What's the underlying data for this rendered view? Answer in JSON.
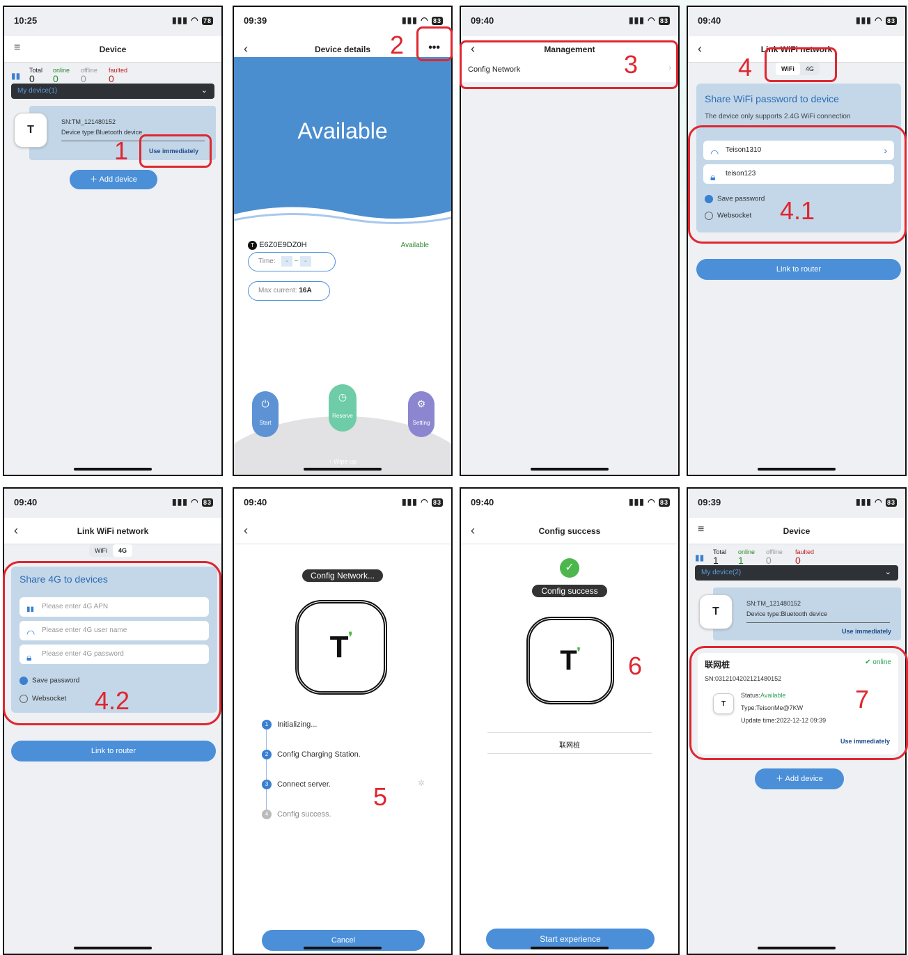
{
  "p1": {
    "time": "10:25",
    "batt": "78",
    "title": "Device",
    "total_l": "Total",
    "total_v": "0",
    "online_l": "online",
    "online_v": "0",
    "offline_l": "offline",
    "offline_v": "0",
    "faulted_l": "faulted",
    "faulted_v": "0",
    "my_device": "My device(1)",
    "sn": "SN:TM_121480152",
    "type": "Device type:Bluetooth device",
    "use": "Use immediately",
    "add": "Add device",
    "step": "1"
  },
  "p2": {
    "time": "09:39",
    "batt": "83",
    "title": "Device details",
    "status_big": "Available",
    "dev_id": "E6Z0E9DZ0H",
    "dev_status": "Available",
    "time_l": "Time:",
    "dash1": "-",
    "tilde": "~",
    "dash2": "-",
    "maxc_l": "Max current:",
    "maxc_v": "16A",
    "start": "Start",
    "reserve": "Reserve",
    "setting": "Setting",
    "wipe": "↑ Wipe up",
    "step": "2"
  },
  "p3": {
    "time": "09:40",
    "batt": "83",
    "title": "Management",
    "item": "Config Network",
    "step": "3"
  },
  "p4": {
    "time": "09:40",
    "batt": "83",
    "title": "Link WiFi network",
    "tab_wifi": "WiFi",
    "tab_4g": "4G",
    "heading": "Share WiFi password to device",
    "note": "The device only supports 2.4G WiFi connection",
    "ssid": "Teison1310",
    "pwd": "teison123",
    "save": "Save password",
    "ws": "Websocket",
    "link": "Link to router",
    "step": "4",
    "step2": "4.1"
  },
  "p5": {
    "time": "09:40",
    "batt": "83",
    "title": "Link WiFi network",
    "tab_wifi": "WiFi",
    "tab_4g": "4G",
    "heading": "Share 4G to devices",
    "apn": "Please enter 4G APN",
    "user": "Please enter 4G user name",
    "pwd": "Please enter 4G password",
    "save": "Save password",
    "ws": "Websocket",
    "link": "Link to router",
    "step": "4.2"
  },
  "p6": {
    "time": "09:40",
    "batt": "83",
    "badge": "Config Network...",
    "s1": "Initializing...",
    "s2": "Config Charging Station.",
    "s3": "Connect server.",
    "s4": "Config success.",
    "n1": "1",
    "n2": "2",
    "n3": "3",
    "n4": "4",
    "cancel": "Cancel",
    "step": "5"
  },
  "p7": {
    "time": "09:40",
    "batt": "83",
    "title": "Config success",
    "badge": "Config success",
    "name": "联网桩",
    "start": "Start experience",
    "step": "6"
  },
  "p8": {
    "time": "09:39",
    "batt": "83",
    "title": "Device",
    "total_l": "Total",
    "total_v": "1",
    "online_l": "online",
    "online_v": "1",
    "offline_l": "offline",
    "offline_v": "0",
    "faulted_l": "faulted",
    "faulted_v": "0",
    "my_device": "My device(2)",
    "sn": "SN:TM_121480152",
    "type": "Device type:Bluetooth device",
    "use": "Use immediately",
    "name": "联网桩",
    "online": "online",
    "sn2": "SN:0312104202121480152",
    "status_l": "Status:",
    "status_v": "Available",
    "type2": "Type:TeisonMe@7KW",
    "upd": "Update time:2022-12-12 09:39",
    "use2": "Use immediately",
    "add": "Add device",
    "step": "7"
  },
  "colors": {
    "accent": "#4a8fd8",
    "red": "#e0262f",
    "green": "#3aa55a",
    "card": "#c2d6e8"
  }
}
